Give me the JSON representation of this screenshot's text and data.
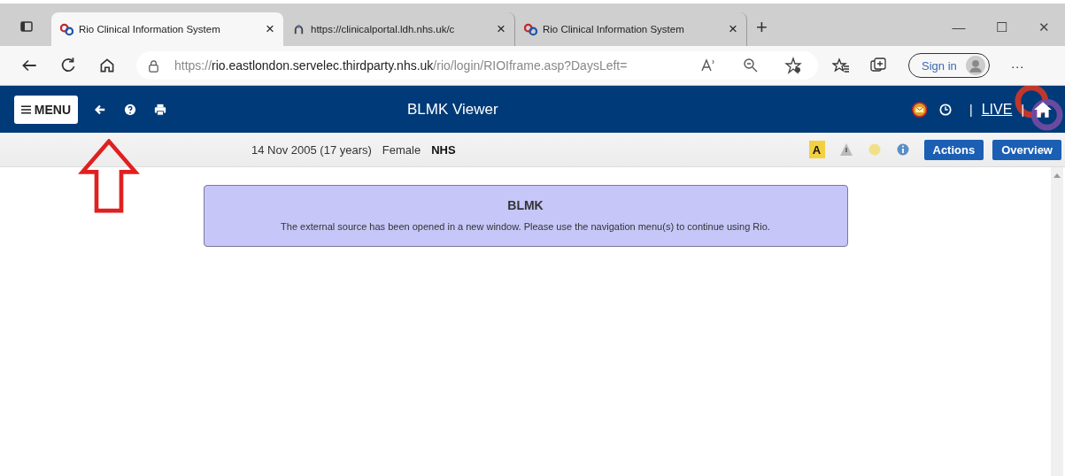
{
  "browser": {
    "tabs": [
      {
        "title": "Rio Clinical Information System",
        "kind": "rio",
        "selected": true,
        "close": "×"
      },
      {
        "title": "https://clinicalportal.ldh.nhs.uk/c",
        "kind": "portal",
        "selected": false,
        "close": "×"
      },
      {
        "title": "Rio Clinical Information System",
        "kind": "rio",
        "selected": false,
        "close": "×"
      }
    ],
    "new_tab": "+",
    "window_controls": [
      "—",
      "☐",
      "✕"
    ],
    "url": {
      "host_prefix": "https://",
      "host": "rio.eastlondon.servelec.thirdparty.nhs.uk",
      "path": "/rio/login/RIOIframe.asp?DaysLeft="
    },
    "sign_in": "Sign in",
    "more": "···"
  },
  "app": {
    "menu": "MENU",
    "title": "BLMK Viewer",
    "live": "LIVE",
    "separator": "|"
  },
  "patient": {
    "dob": "14 Nov 2005 (17 years)",
    "gender": "Female",
    "nhs": "NHS",
    "alert_letter": "A",
    "buttons": [
      "Actions",
      "Overview"
    ]
  },
  "notice": {
    "title": "BLMK",
    "message": "The external source has been opened in a new window. Please use the navigation menu(s) to continue using Rio."
  }
}
